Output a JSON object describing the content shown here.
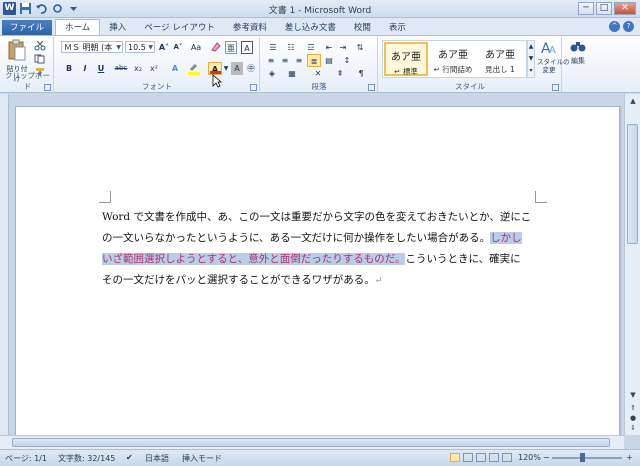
{
  "window": {
    "title": "文書 1 - Microsoft Word",
    "app_icon": "W",
    "minimize": "─",
    "maximize": "□",
    "close": "✕"
  },
  "tabs": [
    {
      "label": "ファイル"
    },
    {
      "label": "ホーム"
    },
    {
      "label": "挿入"
    },
    {
      "label": "ページ レイアウト"
    },
    {
      "label": "参考資料"
    },
    {
      "label": "差し込み文書"
    },
    {
      "label": "校閲"
    },
    {
      "label": "表示"
    }
  ],
  "ribbon": {
    "clipboard": {
      "label": "クリップボード",
      "paste": "貼り付け"
    },
    "font": {
      "label": "フォント",
      "font_name": "ＭＳ 明朝 (本",
      "font_size": "10.5",
      "bold": "B",
      "italic": "I",
      "underline": "U",
      "strike": "abc",
      "sub": "x₂",
      "sup": "x²",
      "grow": "A˄",
      "shrink": "A˅",
      "aa": "Aa",
      "font_color_icon": "A",
      "highlight_color": "#ffff00",
      "font_color": "#e03020"
    },
    "paragraph": {
      "label": "段落"
    },
    "styles": {
      "label": "スタイル",
      "items": [
        {
          "preview": "あア亜",
          "name": "↵ 標準"
        },
        {
          "preview": "あア亜",
          "name": "↵ 行間詰め"
        },
        {
          "preview": "あア亜",
          "name": "見出し 1"
        }
      ],
      "change_styles": "スタイルの\n変更"
    },
    "editing": {
      "label": "編集"
    }
  },
  "document": {
    "line1": "Word で文書を作成中、あ、この一文は重要だから文字の色を変えておきたいとか、逆にこ",
    "line2_a": "の一文いらなかったというように、ある一文だけに何か操作をしたい場合がある。",
    "line2_sel": "しかし",
    "line3_sel": "いざ範囲選択しようとすると、意外と面倒だったりするものだ。",
    "line3_b": "こういうときに、確実に",
    "line4": "その一文だけをパッと選択することができるワザがある。",
    "para_mark": "↵",
    "selection_color": "#b0306e"
  },
  "status": {
    "page": "ページ: 1/1",
    "words": "文字数: 32/145",
    "language": "日本語",
    "mode": "挿入モード",
    "zoom": "120%",
    "zoom_minus": "−",
    "zoom_plus": "+"
  }
}
